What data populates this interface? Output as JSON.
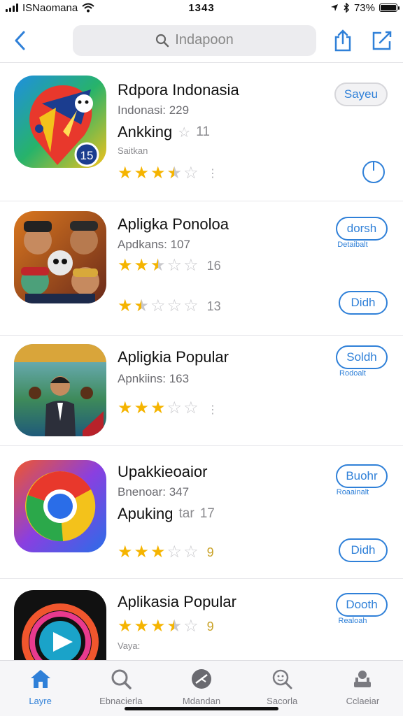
{
  "status": {
    "carrier": "ISNaomana",
    "time": "1343",
    "battery": "73%"
  },
  "nav": {
    "search_placeholder": "Indapoon"
  },
  "apps": [
    {
      "title": "Rdpora Indonasia",
      "subtitle": "Indonasi: 229",
      "rank_label": "Ankking",
      "rank_value": "11",
      "small": "Saitkan",
      "rating": 3.5,
      "rating_count": "",
      "action_label": "Sayeu",
      "action_type": "gray-pill-and-download",
      "icon": "map-pin-game-icon"
    },
    {
      "title": "Apligka Ponoloa",
      "subtitle": "Apdkans: 107",
      "rating": 2.5,
      "rating_count": "16",
      "rating2": 1.5,
      "rating2_count": "13",
      "action_label": "dorsh",
      "action_sub": "Detaibalt",
      "action2_label": "Didh",
      "icon": "character-group-icon"
    },
    {
      "title": "Apligkia Popular",
      "subtitle": "Apnkiins: 163",
      "rating": 3,
      "action_label": "Soldh",
      "action_sub": "Rodoalt",
      "icon": "man-with-props-icon"
    },
    {
      "title": "Upakkieoaior",
      "subtitle": "Bnenoar: 347",
      "rank_label": "Apuking",
      "rank_value": "17",
      "rank_mid": "tar",
      "rating": 3,
      "rating_count": "9",
      "action_label": "Buohr",
      "action_sub": "Roaainalt",
      "action2_label": "Didh",
      "icon": "chrome-like-icon"
    },
    {
      "title": "Aplikasia Popular",
      "subtitle": "Vaya:",
      "rating": 3.5,
      "rating_count": "9",
      "action_label": "Dooth",
      "action_sub": "Realoah",
      "icon": "play-ring-icon"
    }
  ],
  "tabs": [
    {
      "label": "Layre",
      "icon": "home-icon",
      "active": true
    },
    {
      "label": "Ebnacierla",
      "icon": "search-icon",
      "active": false
    },
    {
      "label": "Mdandan",
      "icon": "compass-icon",
      "active": false
    },
    {
      "label": "Sacorla",
      "icon": "magnifier-face-icon",
      "active": false
    },
    {
      "label": "Cclaeiar",
      "icon": "person-stack-icon",
      "active": false
    }
  ],
  "colors": {
    "accent": "#2f80d8",
    "star": "#f5b400"
  }
}
